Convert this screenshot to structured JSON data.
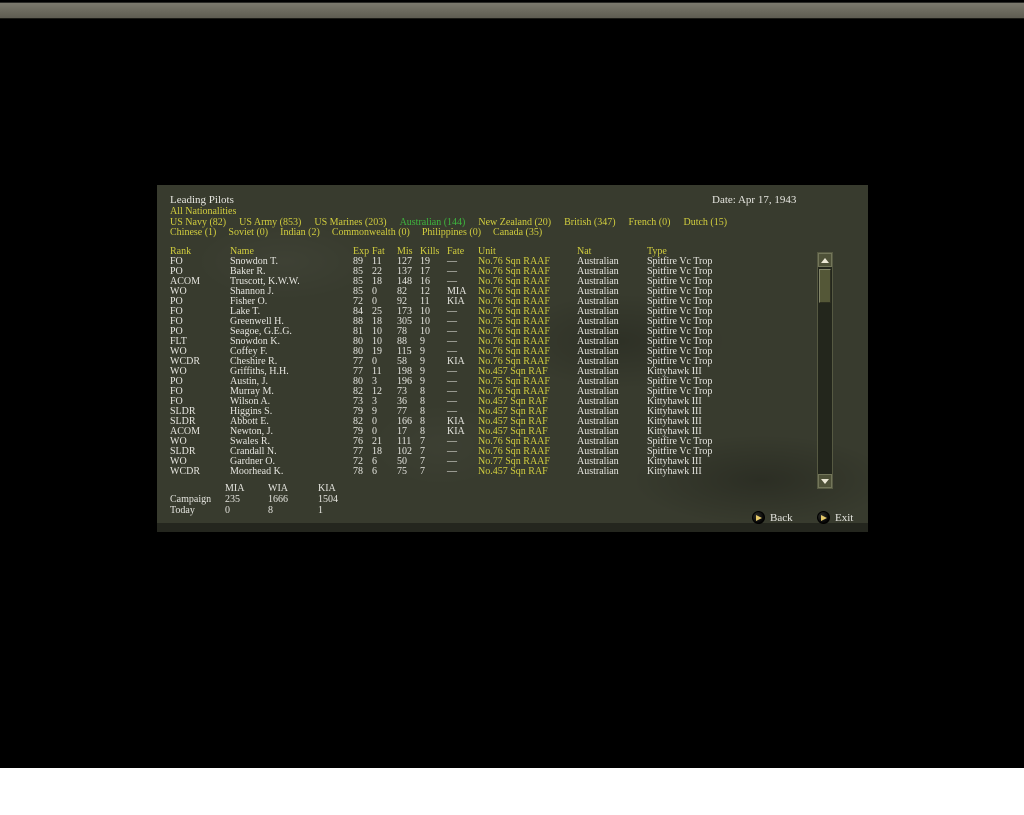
{
  "header": {
    "title": "Leading Pilots",
    "date": "Date: Apr 17, 1943",
    "filter_label": "All Nationalities"
  },
  "tabs_row1": [
    {
      "label": "US Navy (82)",
      "state": ""
    },
    {
      "label": "US Army (853)",
      "state": ""
    },
    {
      "label": "US Marines (203)",
      "state": ""
    },
    {
      "label": "Australian (144)",
      "state": "active"
    },
    {
      "label": "New Zealand (20)",
      "state": ""
    },
    {
      "label": "British (347)",
      "state": ""
    },
    {
      "label": "French (0)",
      "state": ""
    },
    {
      "label": "Dutch (15)",
      "state": ""
    }
  ],
  "tabs_row2": [
    {
      "label": "Chinese (1)",
      "state": ""
    },
    {
      "label": "Soviet (0)",
      "state": ""
    },
    {
      "label": "Indian (2)",
      "state": ""
    },
    {
      "label": "Commonwealth (0)",
      "state": ""
    },
    {
      "label": "Philippines (0)",
      "state": ""
    },
    {
      "label": "Canada (35)",
      "state": ""
    }
  ],
  "table": {
    "headers": {
      "rank": "Rank",
      "name": "Name",
      "exp": "Exp",
      "fat": "Fat",
      "mis": "Mis",
      "kills": "Kills",
      "fate": "Fate",
      "unit": "Unit",
      "nat": "Nat",
      "type": "Type"
    },
    "rows": [
      {
        "rank": "FO",
        "name": "Snowdon T.",
        "exp": "89",
        "fat": "11",
        "mis": "127",
        "kills": "19",
        "fate": "—",
        "unit": "No.76 Sqn RAAF",
        "nat": "Australian",
        "type": "Spitfire Vc Trop"
      },
      {
        "rank": "PO",
        "name": "Baker R.",
        "exp": "85",
        "fat": "22",
        "mis": "137",
        "kills": "17",
        "fate": "—",
        "unit": "No.76 Sqn RAAF",
        "nat": "Australian",
        "type": "Spitfire Vc Trop"
      },
      {
        "rank": "ACOM",
        "name": "Truscott, K.W.W.",
        "exp": "85",
        "fat": "18",
        "mis": "148",
        "kills": "16",
        "fate": "—",
        "unit": "No.76 Sqn RAAF",
        "nat": "Australian",
        "type": "Spitfire Vc Trop"
      },
      {
        "rank": "WO",
        "name": "Shannon J.",
        "exp": "85",
        "fat": "0",
        "mis": "82",
        "kills": "12",
        "fate": "MIA",
        "unit": "No.76 Sqn RAAF",
        "nat": "Australian",
        "type": "Spitfire Vc Trop"
      },
      {
        "rank": "PO",
        "name": "Fisher O.",
        "exp": "72",
        "fat": "0",
        "mis": "92",
        "kills": "11",
        "fate": "KIA",
        "unit": "No.76 Sqn RAAF",
        "nat": "Australian",
        "type": "Spitfire Vc Trop"
      },
      {
        "rank": "FO",
        "name": "Lake T.",
        "exp": "84",
        "fat": "25",
        "mis": "173",
        "kills": "10",
        "fate": "—",
        "unit": "No.76 Sqn RAAF",
        "nat": "Australian",
        "type": "Spitfire Vc Trop"
      },
      {
        "rank": "FO",
        "name": "Greenwell H.",
        "exp": "88",
        "fat": "18",
        "mis": "305",
        "kills": "10",
        "fate": "—",
        "unit": "No.75 Sqn RAAF",
        "nat": "Australian",
        "type": "Spitfire Vc Trop"
      },
      {
        "rank": "PO",
        "name": "Seagoe, G.E.G.",
        "exp": "81",
        "fat": "10",
        "mis": "78",
        "kills": "10",
        "fate": "—",
        "unit": "No.76 Sqn RAAF",
        "nat": "Australian",
        "type": "Spitfire Vc Trop"
      },
      {
        "rank": "FLT",
        "name": "Snowdon K.",
        "exp": "80",
        "fat": "10",
        "mis": "88",
        "kills": "9",
        "fate": "—",
        "unit": "No.76 Sqn RAAF",
        "nat": "Australian",
        "type": "Spitfire Vc Trop"
      },
      {
        "rank": "WO",
        "name": "Coffey F.",
        "exp": "80",
        "fat": "19",
        "mis": "115",
        "kills": "9",
        "fate": "—",
        "unit": "No.76 Sqn RAAF",
        "nat": "Australian",
        "type": "Spitfire Vc Trop"
      },
      {
        "rank": "WCDR",
        "name": "Cheshire R.",
        "exp": "77",
        "fat": "0",
        "mis": "58",
        "kills": "9",
        "fate": "KIA",
        "unit": "No.76 Sqn RAAF",
        "nat": "Australian",
        "type": "Spitfire Vc Trop"
      },
      {
        "rank": "WO",
        "name": "Griffiths, H.H.",
        "exp": "77",
        "fat": "11",
        "mis": "198",
        "kills": "9",
        "fate": "—",
        "unit": "No.457 Sqn RAF",
        "nat": "Australian",
        "type": "Kittyhawk III"
      },
      {
        "rank": "PO",
        "name": "Austin, J.",
        "exp": "80",
        "fat": "3",
        "mis": "196",
        "kills": "9",
        "fate": "—",
        "unit": "No.75 Sqn RAAF",
        "nat": "Australian",
        "type": "Spitfire Vc Trop"
      },
      {
        "rank": "FO",
        "name": "Murray M.",
        "exp": "82",
        "fat": "12",
        "mis": "73",
        "kills": "8",
        "fate": "—",
        "unit": "No.76 Sqn RAAF",
        "nat": "Australian",
        "type": "Spitfire Vc Trop"
      },
      {
        "rank": "FO",
        "name": "Wilson A.",
        "exp": "73",
        "fat": "3",
        "mis": "36",
        "kills": "8",
        "fate": "—",
        "unit": "No.457 Sqn RAF",
        "nat": "Australian",
        "type": "Kittyhawk III"
      },
      {
        "rank": "SLDR",
        "name": "Higgins S.",
        "exp": "79",
        "fat": "9",
        "mis": "77",
        "kills": "8",
        "fate": "—",
        "unit": "No.457 Sqn RAF",
        "nat": "Australian",
        "type": "Kittyhawk III"
      },
      {
        "rank": "SLDR",
        "name": "Abbott E.",
        "exp": "82",
        "fat": "0",
        "mis": "166",
        "kills": "8",
        "fate": "KIA",
        "unit": "No.457 Sqn RAF",
        "nat": "Australian",
        "type": "Kittyhawk III"
      },
      {
        "rank": "ACOM",
        "name": "Newton, J.",
        "exp": "79",
        "fat": "0",
        "mis": "17",
        "kills": "8",
        "fate": "KIA",
        "unit": "No.457 Sqn RAF",
        "nat": "Australian",
        "type": "Kittyhawk III"
      },
      {
        "rank": "WO",
        "name": "Swales R.",
        "exp": "76",
        "fat": "21",
        "mis": "111",
        "kills": "7",
        "fate": "—",
        "unit": "No.76 Sqn RAAF",
        "nat": "Australian",
        "type": "Spitfire Vc Trop"
      },
      {
        "rank": "SLDR",
        "name": "Crandall N.",
        "exp": "77",
        "fat": "18",
        "mis": "102",
        "kills": "7",
        "fate": "—",
        "unit": "No.76 Sqn RAAF",
        "nat": "Australian",
        "type": "Spitfire Vc Trop"
      },
      {
        "rank": "WO",
        "name": "Gardner O.",
        "exp": "72",
        "fat": "6",
        "mis": "50",
        "kills": "7",
        "fate": "—",
        "unit": "No.77 Sqn RAAF",
        "nat": "Australian",
        "type": "Kittyhawk III"
      },
      {
        "rank": "WCDR",
        "name": "Moorhead K.",
        "exp": "78",
        "fat": "6",
        "mis": "75",
        "kills": "7",
        "fate": "—",
        "unit": "No.457 Sqn RAF",
        "nat": "Australian",
        "type": "Kittyhawk III"
      }
    ]
  },
  "summary": {
    "col1": "MIA",
    "col2": "WIA",
    "col3": "KIA",
    "rows": [
      {
        "label": "Campaign",
        "mia": "235",
        "wia": "1666",
        "kia": "1504"
      },
      {
        "label": "Today",
        "mia": "0",
        "wia": "8",
        "kia": "1"
      }
    ]
  },
  "buttons": {
    "back": "Back",
    "exit": "Exit"
  },
  "colors": {
    "accent_yellow": "#d2ce3e",
    "accent_green": "#3eb53e",
    "text_white": "#e6e6e0",
    "panel_bg": "#383b2e"
  }
}
